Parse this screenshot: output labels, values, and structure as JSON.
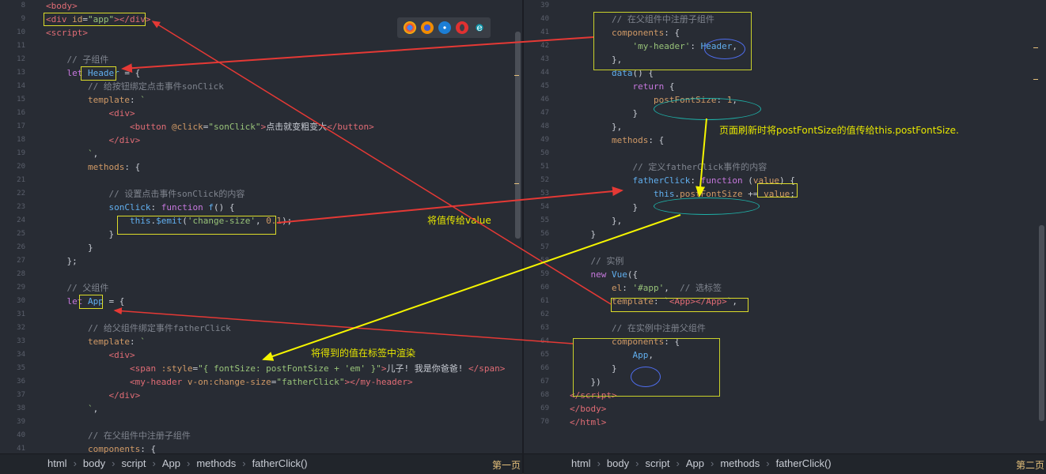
{
  "left": {
    "line_numbers": [
      "8",
      "9",
      "10",
      "11",
      "12",
      "13",
      "14",
      "15",
      "16",
      "17",
      "18",
      "19",
      "20",
      "21",
      "22",
      "23",
      "24",
      "25",
      "26",
      "27",
      "28",
      "29",
      "30",
      "31",
      "32",
      "33",
      "34",
      "35",
      "36",
      "37",
      "38",
      "39",
      "40",
      "41"
    ],
    "breadcrumbs": [
      "html",
      "body",
      "script",
      "App",
      "methods",
      "fatherClick()"
    ],
    "page_label": "第一页"
  },
  "right": {
    "line_numbers": [
      "39",
      "40",
      "41",
      "42",
      "43",
      "44",
      "45",
      "46",
      "47",
      "48",
      "49",
      "50",
      "51",
      "52",
      "53",
      "54",
      "55",
      "56",
      "57",
      "58",
      "59",
      "60",
      "61",
      "62",
      "63",
      "64",
      "65",
      "66",
      "67",
      "68",
      "69",
      "70"
    ],
    "breadcrumbs": [
      "html",
      "body",
      "script",
      "App",
      "methods",
      "fatherClick()"
    ],
    "page_label": "第二页"
  },
  "annotations": {
    "pass_value": "将值传给value",
    "render_value": "将得到的值在标签中渲染",
    "refresh_note": "页面刷新时将postFontSize的值传给this.postFontSize."
  },
  "browser_icons": [
    "chrome-icon",
    "firefox-icon",
    "safari-icon",
    "opera-icon",
    "ie-icon"
  ],
  "colors": {
    "annotation_yellow": "#e6e600",
    "arrow_red": "#e53935",
    "arrow_yellow": "#f5f500"
  }
}
